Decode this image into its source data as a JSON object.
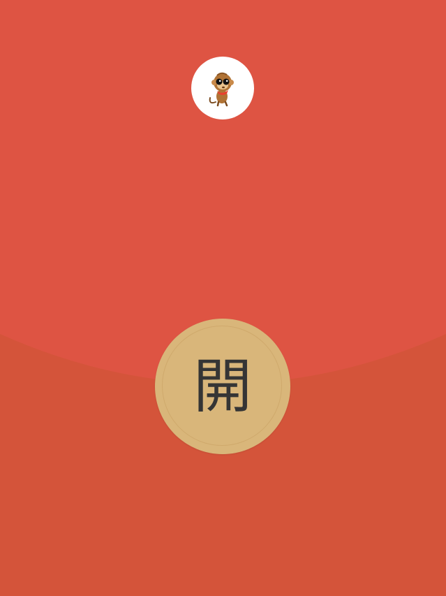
{
  "envelope": {
    "colors": {
      "upper": "#de5443",
      "lower": "#d4543a",
      "button": "#d9b67a",
      "button_ring": "#cfa96c",
      "button_text": "#353535"
    }
  },
  "avatar": {
    "icon": "monkey-mascot-icon"
  },
  "open_button": {
    "label": "開"
  }
}
